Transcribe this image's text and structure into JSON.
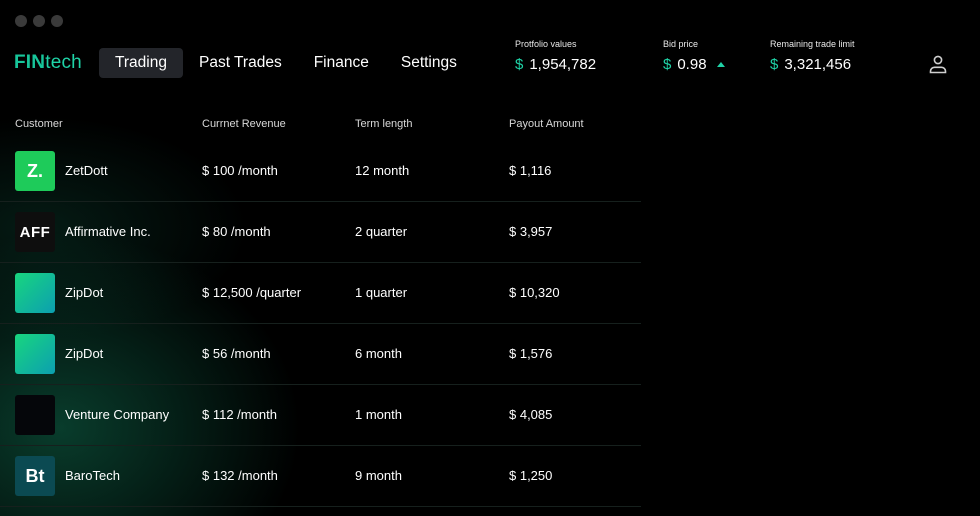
{
  "brand": {
    "bold": "FIN",
    "light": "tech"
  },
  "nav": [
    {
      "label": "Trading",
      "active": true
    },
    {
      "label": "Past Trades",
      "active": false
    },
    {
      "label": "Finance",
      "active": false
    },
    {
      "label": "Settings",
      "active": false
    }
  ],
  "stats": {
    "portfolio": {
      "label": "Protfolio values",
      "currency": "$",
      "value": "1,954,782"
    },
    "bid": {
      "label": "Bid price",
      "currency": "$",
      "value": "0.98",
      "trend_icon": "arrow-up-icon"
    },
    "limit": {
      "label": "Remaining trade limit",
      "currency": "$",
      "value": "3,321,456"
    }
  },
  "user_icon": "user-icon",
  "table": {
    "headers": [
      "Customer",
      "Currnet Revenue",
      "Term length",
      "Payout Amount"
    ],
    "rows": [
      {
        "logo_text": "Z.",
        "logo_color": "#1ecb5a",
        "customer": "ZetDott",
        "revenue": "$ 100 /month",
        "term": "12 month",
        "payout": "$ 1,116"
      },
      {
        "logo_text": "AFF",
        "logo_color": "#0e0e0e",
        "customer": "Affirmative Inc.",
        "revenue": "$ 80 /month",
        "term": "2 quarter",
        "payout": "$ 3,957"
      },
      {
        "logo_text": "",
        "logo_color": "gradient",
        "customer": "ZipDot",
        "revenue": "$ 12,500 /quarter",
        "term": "1 quarter",
        "payout": "$ 10,320"
      },
      {
        "logo_text": "",
        "logo_color": "gradient",
        "customer": "ZipDot",
        "revenue": "$ 56 /month",
        "term": "6 month",
        "payout": "$ 1,576"
      },
      {
        "logo_text": "",
        "logo_color": "#05060a",
        "customer": "Venture Company",
        "revenue": "$ 112 /month",
        "term": "1 month",
        "payout": "$ 4,085"
      },
      {
        "logo_text": "Bt",
        "logo_color": "#0b4a52",
        "customer": "BaroTech",
        "revenue": "$ 132 /month",
        "term": "9 month",
        "payout": "$ 1,250"
      }
    ]
  }
}
